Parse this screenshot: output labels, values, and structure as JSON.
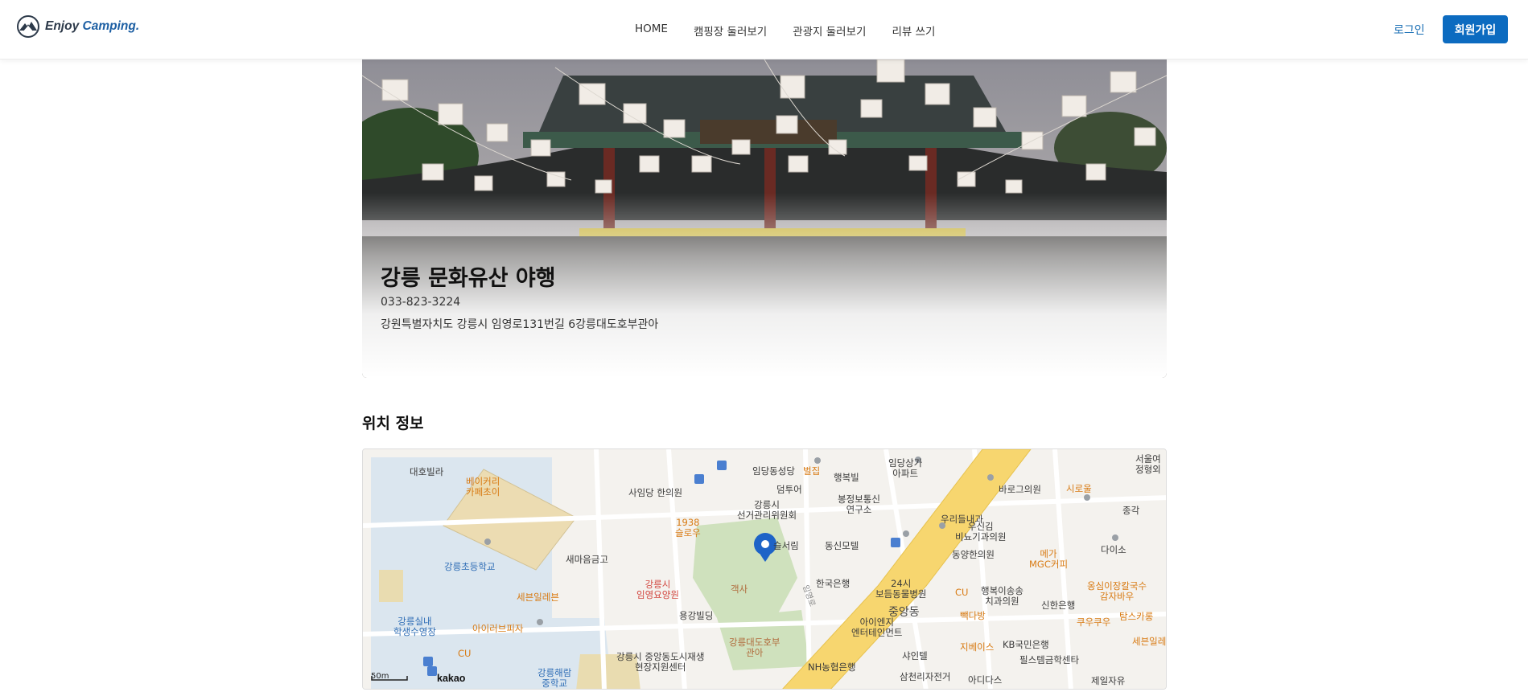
{
  "header": {
    "logo_text_1": "Enjoy",
    "logo_text_2": "Camping.",
    "nav": [
      "HOME",
      "캠핑장 둘러보기",
      "관광지 둘러보기",
      "리뷰 쓰기"
    ],
    "login_label": "로그인",
    "signup_label": "회원가입",
    "accent_color": "#0c6bc0"
  },
  "hero": {
    "title": "강릉 문화유산 야행",
    "phone": "033-823-3224",
    "address": "강원특별자치도 강릉시 임영로131번길 6강릉대도호부관아"
  },
  "location": {
    "section_title": "위치 정보",
    "map_brand": "kakao",
    "scale_label": "50m",
    "labels": [
      "대호빌라",
      "베이커리\n카페초이",
      "사임당 한의원",
      "임당동성당",
      "벌집",
      "임당상가\n아파트",
      "행복빌",
      "서울여\n정형외",
      "덤투어",
      "바로그의원",
      "시로울",
      "1938\n슬로우",
      "강릉시\n선거관리위원회",
      "봉정보통신\n연구소",
      "우리들내과",
      "종각",
      "우신김\n비뇨기과의원",
      "동신모텔",
      "동양한의원",
      "메가\nMGC커피",
      "다이소",
      "새마음금고",
      "슬서림",
      "강릉초등학교",
      "세븐일레븐",
      "강릉시\n임영요양원",
      "객사",
      "한국은행",
      "24시\n보듬동물병원",
      "CU",
      "행복이송송\n치과의원",
      "신한은행",
      "옹심이장칼국수\n감자바우",
      "강릉실내\n학생수영장",
      "아이러브피자",
      "용강빌딩",
      "중앙동",
      "빽다방",
      "쿠우쿠우",
      "탐스카롱",
      "강릉대도호부\n관아",
      "아이엔지\n엔터테인먼트",
      "지베이스",
      "KB국민은행",
      "세븐일레",
      "CU",
      "강릉시 중앙동도시재생\n현장지원센터",
      "샤인텔",
      "NH농협은행",
      "필스템금학센타",
      "강릉해람\n중학교",
      "삼천리자전거",
      "아디다스",
      "제일자유",
      "임영로"
    ]
  }
}
